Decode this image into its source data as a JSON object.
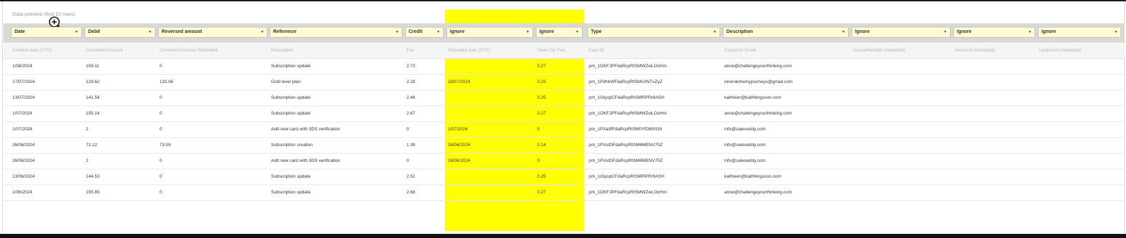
{
  "preview": {
    "title": "Data preview (first 10 rows)"
  },
  "colors": {
    "highlight": "#ffff00",
    "select_bg": "#fffbd5"
  },
  "columns": [
    {
      "mapping": "Date",
      "header": "Created date (UTC)"
    },
    {
      "mapping": "Debit",
      "header": "Converted Amount"
    },
    {
      "mapping": "Reversed amount",
      "header": "Converted Amount Refunded"
    },
    {
      "mapping": "Reference",
      "header": "Description"
    },
    {
      "mapping": "Credit",
      "header": "Fee"
    },
    {
      "mapping": "Ignore",
      "header": "Refunded date (UTC)"
    },
    {
      "mapping": "Ignore",
      "header": "Taxes On Fee"
    },
    {
      "mapping": "Type",
      "header": "Card ID"
    },
    {
      "mapping": "Description",
      "header": "Customer Email"
    },
    {
      "mapping": "Ignore",
      "header": "invoiceNumber (metadata)"
    },
    {
      "mapping": "Ignore",
      "header": "invoiceId (metadata)"
    },
    {
      "mapping": "Ignore",
      "header": "locationId (metadata)"
    }
  ],
  "rows": [
    [
      "1/08/2024",
      "159.11",
      "0",
      "Subscription update",
      "2.73",
      "",
      "0.27",
      "pm_1OKFJPFdaRcpRtSMWZwLOcHm",
      "anne@challengeyourthinking.com",
      "",
      "",
      ""
    ],
    [
      "17/07/2024",
      "129.62",
      "132.06",
      "Gold level plan",
      "2.28",
      "18/07/2024",
      "0.23",
      "pm_1PdhkWFdaRcpRtSMsXNTvZyZ",
      "inneralchemyjourneys@gmail.com",
      "",
      "",
      ""
    ],
    [
      "13/07/2024",
      "141.54",
      "0",
      "Subscription update",
      "2.46",
      "",
      "0.25",
      "pm_1OiyopCFdaRcpRtSMRPRr9ASH",
      "kathleen@kathferguson.com",
      "",
      "",
      ""
    ],
    [
      "1/07/2024",
      "155.14",
      "0",
      "Subscription update",
      "2.67",
      "",
      "0.27",
      "pm_1OKFJPFdaRcpRtSMWZwLOcHm",
      "anne@challengeyourthinking.com",
      "",
      "",
      ""
    ],
    [
      "1/07/2024",
      "2",
      "0",
      "Add new card with 3DS verification",
      "0",
      "1/07/2024",
      "0",
      "pm_1PXa9fFdaRcpRtSM0YfOMVG8",
      "info@salesеddy.com",
      "",
      "",
      ""
    ],
    [
      "26/06/2024",
      "72.12",
      "73.59",
      "Subscription creation",
      "1.39",
      "26/06/2024",
      "0.14",
      "pm_1PVutDFdaRcpRtSM6MENV70Z",
      "info@salesеddy.com",
      "",
      "",
      ""
    ],
    [
      "26/06/2024",
      "2",
      "0",
      "Add new card with 3DS verification",
      "0",
      "26/06/2024",
      "0",
      "pm_1PVutDFdaRcpRtSM6MENV70Z",
      "info@salesеddy.com",
      "",
      "",
      ""
    ],
    [
      "13/06/2024",
      "144.53",
      "0",
      "Subscription update",
      "2.51",
      "",
      "0.25",
      "pm_1OiyopCFdaRcpRtSMRPRr9ASH",
      "kathleen@kathferguson.com",
      "",
      "",
      ""
    ],
    [
      "1/06/2024",
      "155.85",
      "0",
      "Subscription update",
      "2.68",
      "",
      "0.27",
      "pm_1OKFJPFdaRcpRtSMWZwLOcHm",
      "anne@challengeyourthinking.com",
      "",
      "",
      ""
    ]
  ]
}
